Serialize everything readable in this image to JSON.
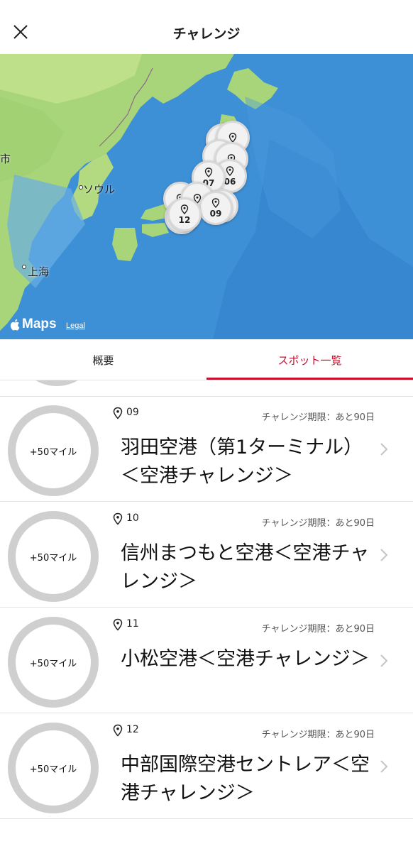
{
  "header": {
    "title": "チャレンジ",
    "close_icon": "close-icon"
  },
  "map": {
    "labels": {
      "seoul": "ソウル",
      "shanghai": "上海",
      "city_partial": "市"
    },
    "pins": [
      "07",
      "06",
      "09",
      "12"
    ],
    "attribution": {
      "maps": "Maps",
      "legal": "Legal"
    }
  },
  "tabs": {
    "overview": "概要",
    "spots": "スポット一覧",
    "active": "スポット一覧",
    "active_color": "#c8102e"
  },
  "spots": [
    {
      "number": "09",
      "deadline": "チャレンジ期限：あと90日",
      "name": "羽田空港（第1ターミナル）＜空港チャレンジ＞",
      "reward": "+50マイル"
    },
    {
      "number": "10",
      "deadline": "チャレンジ期限：あと90日",
      "name": "信州まつもと空港＜空港チャレンジ＞",
      "reward": "+50マイル"
    },
    {
      "number": "11",
      "deadline": "チャレンジ期限：あと90日",
      "name": "小松空港＜空港チャレンジ＞",
      "reward": "+50マイル"
    },
    {
      "number": "12",
      "deadline": "チャレンジ期限：あと90日",
      "name": "中部国際空港セントレア＜空港チャレンジ＞",
      "reward": "+50マイル"
    }
  ]
}
